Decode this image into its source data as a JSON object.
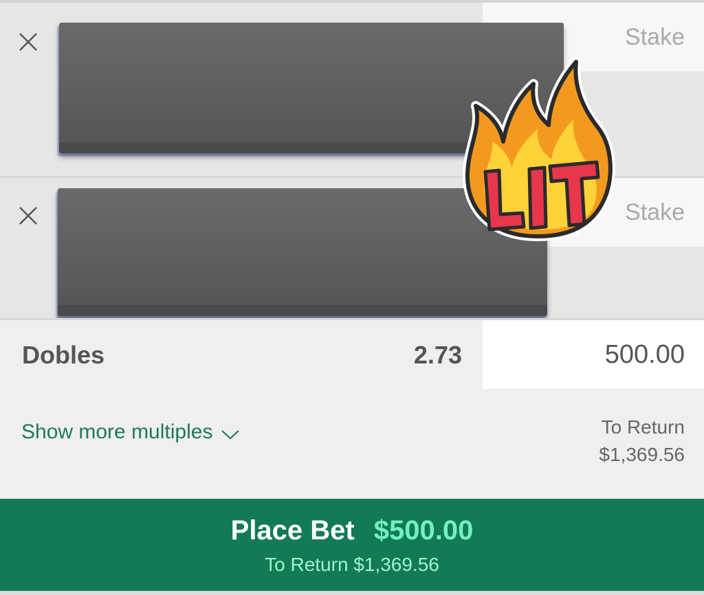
{
  "bet_rows": [
    {
      "close_icon": "close-icon",
      "stake_placeholder": "Stake"
    },
    {
      "close_icon": "close-icon",
      "stake_placeholder": "Stake"
    }
  ],
  "doubles": {
    "label": "Dobles",
    "odds": "2.73",
    "stake_value": "500.00"
  },
  "multiples": {
    "show_more_label": "Show more multiples",
    "chevron_icon": "chevron-down-icon",
    "to_return_label": "To Return",
    "to_return_value": "$1,369.56"
  },
  "place_bet": {
    "label": "Place Bet",
    "amount": "$500.00",
    "return_text": "To Return $1,369.56"
  },
  "sticker": {
    "text": "LIT",
    "icon": "fire-sticker-icon"
  },
  "colors": {
    "brand_green": "#127a55",
    "amount_green": "#74f0c0",
    "link_green": "#1e7a56"
  }
}
